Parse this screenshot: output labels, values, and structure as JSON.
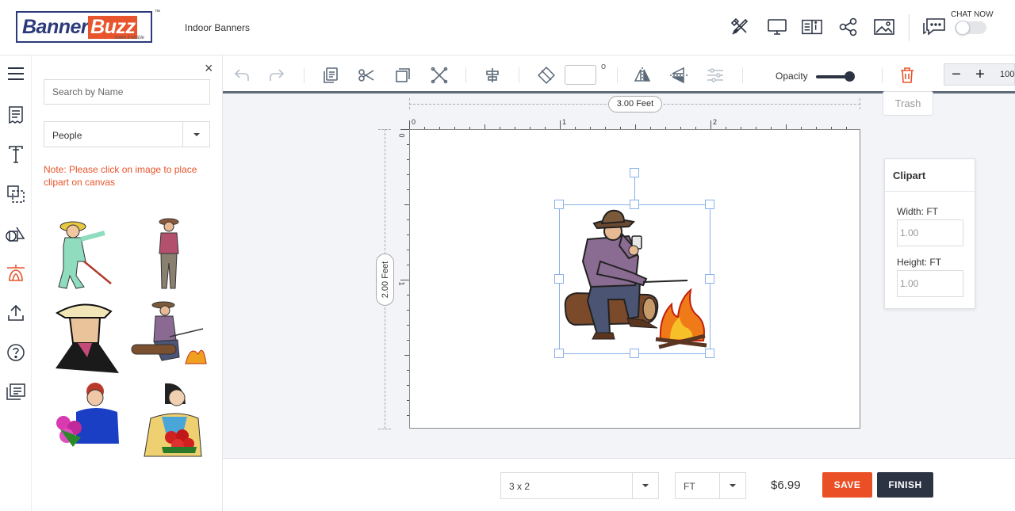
{
  "header": {
    "logo": {
      "word1": "Banner",
      "word2": "Buzz",
      "tagline": "make it visible",
      "tm": "™"
    },
    "product_title": "Indoor Banners",
    "icons": [
      "design-tools-icon",
      "preview-icon",
      "guide-icon",
      "share-icon",
      "image-icon",
      "chat-icon"
    ],
    "chat_label": "CHAT NOW",
    "chat_enabled": false
  },
  "rail": {
    "icons": [
      "menu-icon",
      "template-icon",
      "text-icon",
      "background-icon",
      "shapes-icon",
      "clipart-icon",
      "upload-icon",
      "help-icon",
      "notes-icon"
    ],
    "active": "clipart-icon",
    "active_color": "#e8542b"
  },
  "panel": {
    "close": "×",
    "search_placeholder": "Search by Name",
    "category": "People",
    "note": "Note: Please click on image to place clipart on canvas",
    "note_color": "#e8542b"
  },
  "toolbar": {
    "rotation_unit": "o",
    "opacity_label": "Opacity",
    "opacity": 1.0,
    "zoom_minus": "−",
    "zoom_plus": "+",
    "zoom_value": "100",
    "trash_tooltip": "Trash"
  },
  "canvas": {
    "width_label": "3.00 Feet",
    "height_label": "2.00 Feet",
    "ruler_h": [
      "0",
      "1",
      "2"
    ],
    "ruler_v": [
      "0",
      "1"
    ]
  },
  "properties": {
    "title": "Clipart",
    "width_label": "Width: FT",
    "width_value": "1.00",
    "height_label": "Height: FT",
    "height_value": "1.00"
  },
  "bottom": {
    "size": "3 x 2",
    "unit": "FT",
    "price": "$6.99",
    "save": "SAVE",
    "finish": "FINISH",
    "save_color": "#ea4f25",
    "finish_color": "#2c3444"
  }
}
